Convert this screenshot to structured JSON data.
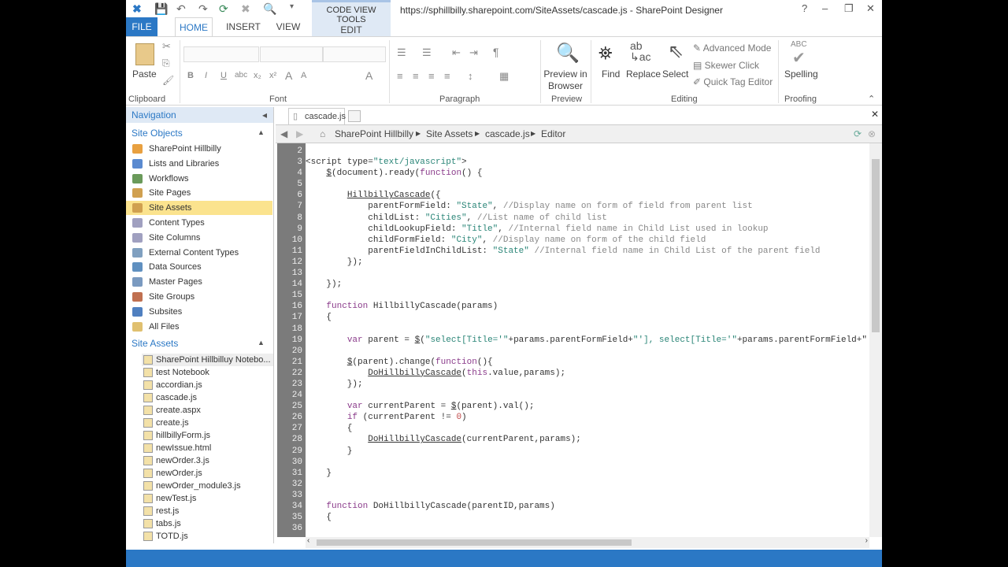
{
  "titlebar": {
    "context_group": "CODE VIEW TOOLS",
    "window_title": "https://sphillbilly.sharepoint.com/SiteAssets/cascade.js - SharePoint Designer",
    "help": "?",
    "minimize": "–",
    "restore": "❐",
    "close": "✕"
  },
  "tabs": {
    "file": "FILE",
    "home": "HOME",
    "insert": "INSERT",
    "view": "VIEW",
    "edit": "EDIT"
  },
  "ribbon": {
    "clipboard": {
      "label": "Clipboard",
      "paste": "Paste"
    },
    "font": {
      "label": "Font",
      "bold": "B",
      "italic": "I",
      "underline": "U",
      "strike": "abc",
      "sub": "x₂",
      "sup": "x²",
      "grow": "A",
      "shrink": "A",
      "color": "A"
    },
    "paragraph": {
      "label": "Paragraph",
      "pilcrow": "¶"
    },
    "preview": {
      "label": "Preview",
      "button": "Preview in Browser"
    },
    "editing": {
      "label": "Editing",
      "find": "Find",
      "replace": "Replace",
      "select": "Select",
      "advanced": "Advanced Mode",
      "skewer": "Skewer Click",
      "quicktag": "Quick Tag Editor"
    },
    "proofing": {
      "label": "Proofing",
      "spelling": "Spelling",
      "abc": "ABC"
    }
  },
  "nav": {
    "title": "Navigation",
    "site_objects_header": "Site Objects",
    "site_objects": [
      "SharePoint Hillbilly",
      "Lists and Libraries",
      "Workflows",
      "Site Pages",
      "Site Assets",
      "Content Types",
      "Site Columns",
      "External Content Types",
      "Data Sources",
      "Master Pages",
      "Site Groups",
      "Subsites",
      "All Files"
    ],
    "selected": "Site Assets",
    "site_assets_header": "Site Assets",
    "site_assets": [
      "SharePoint Hillbilluy Notebo...",
      "test Notebook",
      "accordian.js",
      "cascade.js",
      "create.aspx",
      "create.js",
      "hillbillyForm.js",
      "newIssue.html",
      "newOrder.3.js",
      "newOrder.js",
      "newOrder_module3.js",
      "newTest.js",
      "rest.js",
      "tabs.js",
      "TOTD.js"
    ]
  },
  "editor": {
    "tab": "cascade.js",
    "breadcrumb": [
      "SharePoint Hillbilly",
      "Site Assets",
      "cascade.js",
      "Editor"
    ],
    "first_line": 2,
    "lines": [
      [],
      [
        [
          "p",
          "<script type="
        ],
        [
          "s",
          "\"text/javascript\""
        ],
        [
          "p",
          ">"
        ]
      ],
      [
        [
          "p",
          "    "
        ],
        [
          "u",
          "$"
        ],
        [
          "p",
          "(document).ready("
        ],
        [
          "k",
          "function"
        ],
        [
          "p",
          "() {"
        ]
      ],
      [],
      [
        [
          "p",
          "        "
        ],
        [
          "u",
          "HillbillyCascade"
        ],
        [
          "p",
          "({"
        ]
      ],
      [
        [
          "p",
          "            parentFormField: "
        ],
        [
          "s",
          "\"State\""
        ],
        [
          "p",
          ", "
        ],
        [
          "c",
          "//Display name on form of field from parent list"
        ]
      ],
      [
        [
          "p",
          "            childList: "
        ],
        [
          "s",
          "\"Cities\""
        ],
        [
          "p",
          ", "
        ],
        [
          "c",
          "//List name of child list"
        ]
      ],
      [
        [
          "p",
          "            childLookupField: "
        ],
        [
          "s",
          "\"Title\""
        ],
        [
          "p",
          ", "
        ],
        [
          "c",
          "//Internal field name in Child List used in lookup"
        ]
      ],
      [
        [
          "p",
          "            childFormField: "
        ],
        [
          "s",
          "\"City\""
        ],
        [
          "p",
          ", "
        ],
        [
          "c",
          "//Display name on form of the child field"
        ]
      ],
      [
        [
          "p",
          "            parentFieldInChildList: "
        ],
        [
          "s",
          "\"State\""
        ],
        [
          "p",
          " "
        ],
        [
          "c",
          "//Internal field name in Child List of the parent field"
        ]
      ],
      [
        [
          "p",
          "        });"
        ]
      ],
      [],
      [
        [
          "p",
          "    });"
        ]
      ],
      [],
      [
        [
          "p",
          "    "
        ],
        [
          "k",
          "function"
        ],
        [
          "p",
          " HillbillyCascade(params)"
        ]
      ],
      [
        [
          "p",
          "    {"
        ]
      ],
      [],
      [
        [
          "p",
          "        "
        ],
        [
          "k",
          "var"
        ],
        [
          "p",
          " parent = "
        ],
        [
          "u",
          "$"
        ],
        [
          "p",
          "("
        ],
        [
          "s",
          "\"select[Title='\""
        ],
        [
          "p",
          "+params.parentFormField+"
        ],
        [
          "s",
          "\"'], select[Title='\""
        ],
        [
          "p",
          "+params.parentFormField+\""
        ]
      ],
      [],
      [
        [
          "p",
          "        "
        ],
        [
          "u",
          "$"
        ],
        [
          "p",
          "(parent).change("
        ],
        [
          "k",
          "function"
        ],
        [
          "p",
          "(){"
        ]
      ],
      [
        [
          "p",
          "            "
        ],
        [
          "u",
          "DoHillbillyCascade"
        ],
        [
          "p",
          "("
        ],
        [
          "k",
          "this"
        ],
        [
          "p",
          ".value,params);"
        ]
      ],
      [
        [
          "p",
          "        });"
        ]
      ],
      [],
      [
        [
          "p",
          "        "
        ],
        [
          "k",
          "var"
        ],
        [
          "p",
          " currentParent = "
        ],
        [
          "u",
          "$"
        ],
        [
          "p",
          "(parent).val();"
        ]
      ],
      [
        [
          "p",
          "        "
        ],
        [
          "k",
          "if"
        ],
        [
          "p",
          " (currentParent != "
        ],
        [
          "n",
          "0"
        ],
        [
          "p",
          ")"
        ]
      ],
      [
        [
          "p",
          "        {"
        ]
      ],
      [
        [
          "p",
          "            "
        ],
        [
          "u",
          "DoHillbillyCascade"
        ],
        [
          "p",
          "(currentParent,params);"
        ]
      ],
      [
        [
          "p",
          "        }"
        ]
      ],
      [],
      [
        [
          "p",
          "    }"
        ]
      ],
      [],
      [],
      [
        [
          "p",
          "    "
        ],
        [
          "k",
          "function"
        ],
        [
          "p",
          " DoHillbillyCascade(parentID,params)"
        ]
      ],
      [
        [
          "p",
          "    {"
        ]
      ],
      []
    ]
  }
}
